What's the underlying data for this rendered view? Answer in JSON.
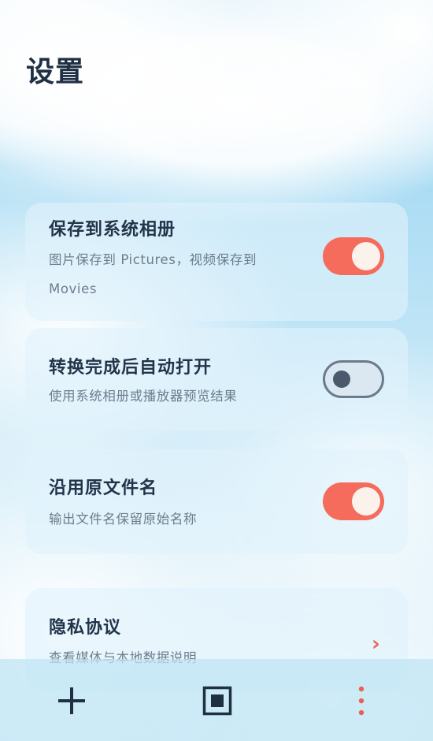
{
  "header": {
    "title": "设置"
  },
  "settings": [
    {
      "title": "保存到系统相册",
      "description": "图片保存到 Pictures，视频保存到 Movies",
      "enabled": true
    },
    {
      "title": "转换完成后自动打开",
      "description": "使用系统相册或播放器预览结果",
      "enabled": false
    },
    {
      "title": "沿用原文件名",
      "description": "输出文件名保留原始名称",
      "enabled": true
    }
  ],
  "privacy": {
    "title": "隐私协议",
    "description": "查看媒体与本地数据说明",
    "icon": "chevron-right-icon"
  },
  "bottom_bar": {
    "buttons": [
      {
        "name": "add",
        "icon": "plus-icon"
      },
      {
        "name": "stop",
        "icon": "stop-square-icon"
      },
      {
        "name": "more",
        "icon": "more-vertical-icon"
      }
    ]
  },
  "colors": {
    "accent": "#f56c5c",
    "title_text": "#22344a",
    "desc_text": "#6c7d8d",
    "toggle_off_border": "#6b7b8c",
    "icon_dark": "#1f3045"
  }
}
